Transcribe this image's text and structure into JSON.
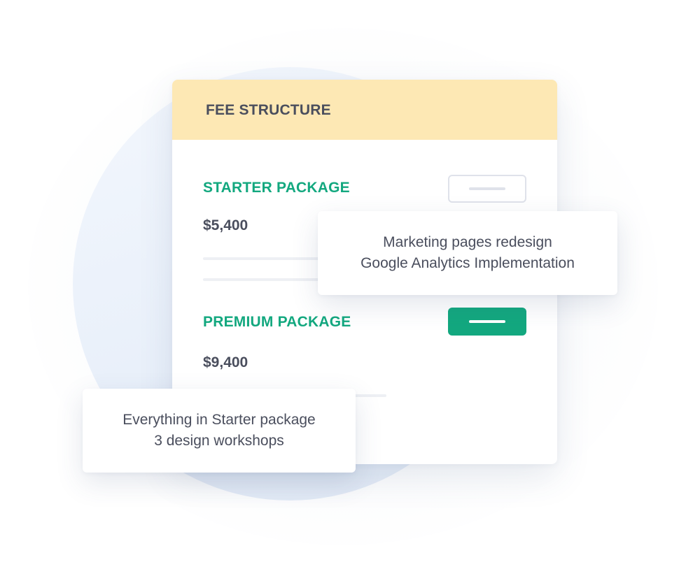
{
  "card": {
    "title": "FEE STRUCTURE"
  },
  "packages": [
    {
      "name": "STARTER PACKAGE",
      "price": "$5,400",
      "button_state": "outline"
    },
    {
      "name": "PREMIUM PACKAGE",
      "price": "$9,400",
      "button_state": "filled"
    }
  ],
  "tooltips": [
    {
      "lines": [
        "Marketing pages redesign",
        "Google Analytics Implementation"
      ]
    },
    {
      "lines": [
        "Everything in Starter package",
        "3 design workshops"
      ]
    }
  ],
  "colors": {
    "header_bg": "#fde8b4",
    "accent_green": "#13a87f",
    "text_dark": "#4a4e5d",
    "muted_line": "#eef0f4"
  }
}
